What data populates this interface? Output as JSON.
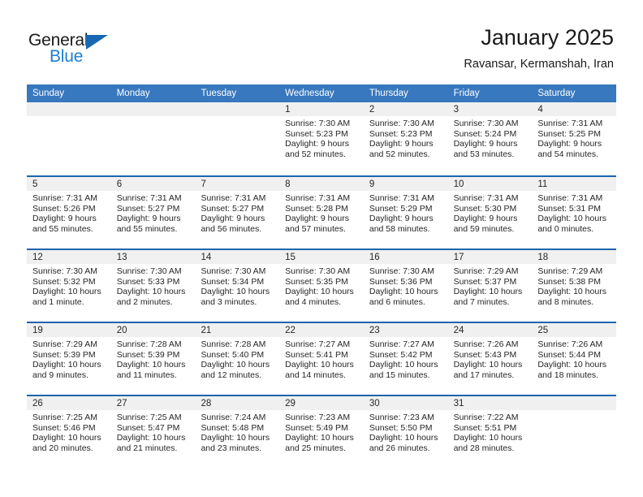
{
  "brand": {
    "name_part1": "General",
    "name_part2": "Blue",
    "triangle_color": "#1668b3",
    "blue_color": "#1a7fd4"
  },
  "header": {
    "title": "January 2025",
    "subtitle": "Ravansar, Kermanshah, Iran"
  },
  "colors": {
    "weekday_header_bg": "#3878be",
    "week_divider": "#1f64ad",
    "day_band_bg": "#f0f0f0",
    "text": "#262626"
  },
  "weekdays": [
    "Sunday",
    "Monday",
    "Tuesday",
    "Wednesday",
    "Thursday",
    "Friday",
    "Saturday"
  ],
  "weeks": [
    [
      {
        "day": "",
        "empty": true
      },
      {
        "day": "",
        "empty": true
      },
      {
        "day": "",
        "empty": true
      },
      {
        "day": "1",
        "sunrise": "Sunrise: 7:30 AM",
        "sunset": "Sunset: 5:23 PM",
        "daylight1": "Daylight: 9 hours",
        "daylight2": "and 52 minutes."
      },
      {
        "day": "2",
        "sunrise": "Sunrise: 7:30 AM",
        "sunset": "Sunset: 5:23 PM",
        "daylight1": "Daylight: 9 hours",
        "daylight2": "and 52 minutes."
      },
      {
        "day": "3",
        "sunrise": "Sunrise: 7:30 AM",
        "sunset": "Sunset: 5:24 PM",
        "daylight1": "Daylight: 9 hours",
        "daylight2": "and 53 minutes."
      },
      {
        "day": "4",
        "sunrise": "Sunrise: 7:31 AM",
        "sunset": "Sunset: 5:25 PM",
        "daylight1": "Daylight: 9 hours",
        "daylight2": "and 54 minutes."
      }
    ],
    [
      {
        "day": "5",
        "sunrise": "Sunrise: 7:31 AM",
        "sunset": "Sunset: 5:26 PM",
        "daylight1": "Daylight: 9 hours",
        "daylight2": "and 55 minutes."
      },
      {
        "day": "6",
        "sunrise": "Sunrise: 7:31 AM",
        "sunset": "Sunset: 5:27 PM",
        "daylight1": "Daylight: 9 hours",
        "daylight2": "and 55 minutes."
      },
      {
        "day": "7",
        "sunrise": "Sunrise: 7:31 AM",
        "sunset": "Sunset: 5:27 PM",
        "daylight1": "Daylight: 9 hours",
        "daylight2": "and 56 minutes."
      },
      {
        "day": "8",
        "sunrise": "Sunrise: 7:31 AM",
        "sunset": "Sunset: 5:28 PM",
        "daylight1": "Daylight: 9 hours",
        "daylight2": "and 57 minutes."
      },
      {
        "day": "9",
        "sunrise": "Sunrise: 7:31 AM",
        "sunset": "Sunset: 5:29 PM",
        "daylight1": "Daylight: 9 hours",
        "daylight2": "and 58 minutes."
      },
      {
        "day": "10",
        "sunrise": "Sunrise: 7:31 AM",
        "sunset": "Sunset: 5:30 PM",
        "daylight1": "Daylight: 9 hours",
        "daylight2": "and 59 minutes."
      },
      {
        "day": "11",
        "sunrise": "Sunrise: 7:31 AM",
        "sunset": "Sunset: 5:31 PM",
        "daylight1": "Daylight: 10 hours",
        "daylight2": "and 0 minutes."
      }
    ],
    [
      {
        "day": "12",
        "sunrise": "Sunrise: 7:30 AM",
        "sunset": "Sunset: 5:32 PM",
        "daylight1": "Daylight: 10 hours",
        "daylight2": "and 1 minute."
      },
      {
        "day": "13",
        "sunrise": "Sunrise: 7:30 AM",
        "sunset": "Sunset: 5:33 PM",
        "daylight1": "Daylight: 10 hours",
        "daylight2": "and 2 minutes."
      },
      {
        "day": "14",
        "sunrise": "Sunrise: 7:30 AM",
        "sunset": "Sunset: 5:34 PM",
        "daylight1": "Daylight: 10 hours",
        "daylight2": "and 3 minutes."
      },
      {
        "day": "15",
        "sunrise": "Sunrise: 7:30 AM",
        "sunset": "Sunset: 5:35 PM",
        "daylight1": "Daylight: 10 hours",
        "daylight2": "and 4 minutes."
      },
      {
        "day": "16",
        "sunrise": "Sunrise: 7:30 AM",
        "sunset": "Sunset: 5:36 PM",
        "daylight1": "Daylight: 10 hours",
        "daylight2": "and 6 minutes."
      },
      {
        "day": "17",
        "sunrise": "Sunrise: 7:29 AM",
        "sunset": "Sunset: 5:37 PM",
        "daylight1": "Daylight: 10 hours",
        "daylight2": "and 7 minutes."
      },
      {
        "day": "18",
        "sunrise": "Sunrise: 7:29 AM",
        "sunset": "Sunset: 5:38 PM",
        "daylight1": "Daylight: 10 hours",
        "daylight2": "and 8 minutes."
      }
    ],
    [
      {
        "day": "19",
        "sunrise": "Sunrise: 7:29 AM",
        "sunset": "Sunset: 5:39 PM",
        "daylight1": "Daylight: 10 hours",
        "daylight2": "and 9 minutes."
      },
      {
        "day": "20",
        "sunrise": "Sunrise: 7:28 AM",
        "sunset": "Sunset: 5:39 PM",
        "daylight1": "Daylight: 10 hours",
        "daylight2": "and 11 minutes."
      },
      {
        "day": "21",
        "sunrise": "Sunrise: 7:28 AM",
        "sunset": "Sunset: 5:40 PM",
        "daylight1": "Daylight: 10 hours",
        "daylight2": "and 12 minutes."
      },
      {
        "day": "22",
        "sunrise": "Sunrise: 7:27 AM",
        "sunset": "Sunset: 5:41 PM",
        "daylight1": "Daylight: 10 hours",
        "daylight2": "and 14 minutes."
      },
      {
        "day": "23",
        "sunrise": "Sunrise: 7:27 AM",
        "sunset": "Sunset: 5:42 PM",
        "daylight1": "Daylight: 10 hours",
        "daylight2": "and 15 minutes."
      },
      {
        "day": "24",
        "sunrise": "Sunrise: 7:26 AM",
        "sunset": "Sunset: 5:43 PM",
        "daylight1": "Daylight: 10 hours",
        "daylight2": "and 17 minutes."
      },
      {
        "day": "25",
        "sunrise": "Sunrise: 7:26 AM",
        "sunset": "Sunset: 5:44 PM",
        "daylight1": "Daylight: 10 hours",
        "daylight2": "and 18 minutes."
      }
    ],
    [
      {
        "day": "26",
        "sunrise": "Sunrise: 7:25 AM",
        "sunset": "Sunset: 5:46 PM",
        "daylight1": "Daylight: 10 hours",
        "daylight2": "and 20 minutes."
      },
      {
        "day": "27",
        "sunrise": "Sunrise: 7:25 AM",
        "sunset": "Sunset: 5:47 PM",
        "daylight1": "Daylight: 10 hours",
        "daylight2": "and 21 minutes."
      },
      {
        "day": "28",
        "sunrise": "Sunrise: 7:24 AM",
        "sunset": "Sunset: 5:48 PM",
        "daylight1": "Daylight: 10 hours",
        "daylight2": "and 23 minutes."
      },
      {
        "day": "29",
        "sunrise": "Sunrise: 7:23 AM",
        "sunset": "Sunset: 5:49 PM",
        "daylight1": "Daylight: 10 hours",
        "daylight2": "and 25 minutes."
      },
      {
        "day": "30",
        "sunrise": "Sunrise: 7:23 AM",
        "sunset": "Sunset: 5:50 PM",
        "daylight1": "Daylight: 10 hours",
        "daylight2": "and 26 minutes."
      },
      {
        "day": "31",
        "sunrise": "Sunrise: 7:22 AM",
        "sunset": "Sunset: 5:51 PM",
        "daylight1": "Daylight: 10 hours",
        "daylight2": "and 28 minutes."
      },
      {
        "day": "",
        "empty": true
      }
    ]
  ]
}
